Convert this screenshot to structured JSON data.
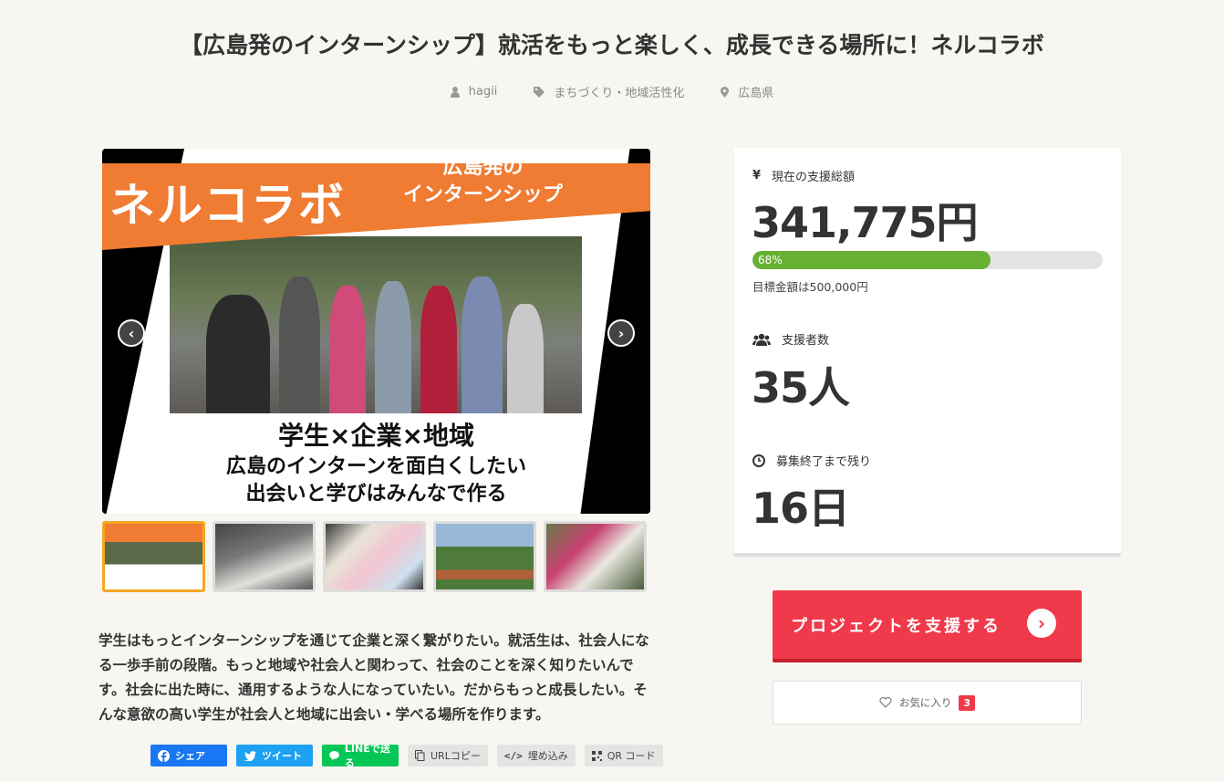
{
  "project": {
    "title": "【広島発のインターンシップ】就活をもっと楽しく、成長できる場所に！ネルコラボ",
    "author": "hagii",
    "category": "まちづくり・地域活性化",
    "location": "広島県"
  },
  "carousel": {
    "slide": {
      "brand": "ネルコラボ",
      "sub_line1": "広島発の",
      "sub_line2": "インターンシップ",
      "caption_line1": "学生×企業×地域",
      "caption_line2": "広島のインターンを面白くしたい",
      "caption_line3": "出会いと学びはみんなで作る"
    },
    "prev_icon": "chevron-left-icon",
    "next_icon": "chevron-right-icon",
    "thumbnails": [
      "thumb-1",
      "thumb-2",
      "thumb-3",
      "thumb-4",
      "thumb-5"
    ],
    "active_thumbnail": 0
  },
  "description": "学生はもっとインターンシップを通じて企業と深く繋がりたい。就活生は、社会人になる一歩手前の段階。もっと地域や社会人と関わって、社会のことを深く知りたいんです。社会に出た時に、通用するような人になっていたい。だからもっと成長したい。そんな意欲の高い学生が社会人と地域に出会い・学べる場所を作ります。",
  "share": {
    "facebook": "シェア",
    "twitter": "ツイート",
    "line": "LINEで送る",
    "url_copy": "URLコピー",
    "embed": "埋め込み",
    "qr": "QR コード"
  },
  "stats": {
    "total_label": "現在の支援総額",
    "total_value": "341,775円",
    "progress_label": "68%",
    "progress_fraction": 0.68,
    "goal": "目標金額は500,000円",
    "supporters_label": "支援者数",
    "supporters_value": "35人",
    "remaining_label": "募集終了まで残り",
    "remaining_value": "16日"
  },
  "actions": {
    "support": "プロジェクトを支援する",
    "favorite": "お気に入り",
    "favorite_count": "3"
  },
  "colors": {
    "support": "#f0394a",
    "progress": "#66b032",
    "active_thumb": "#f5a623"
  }
}
